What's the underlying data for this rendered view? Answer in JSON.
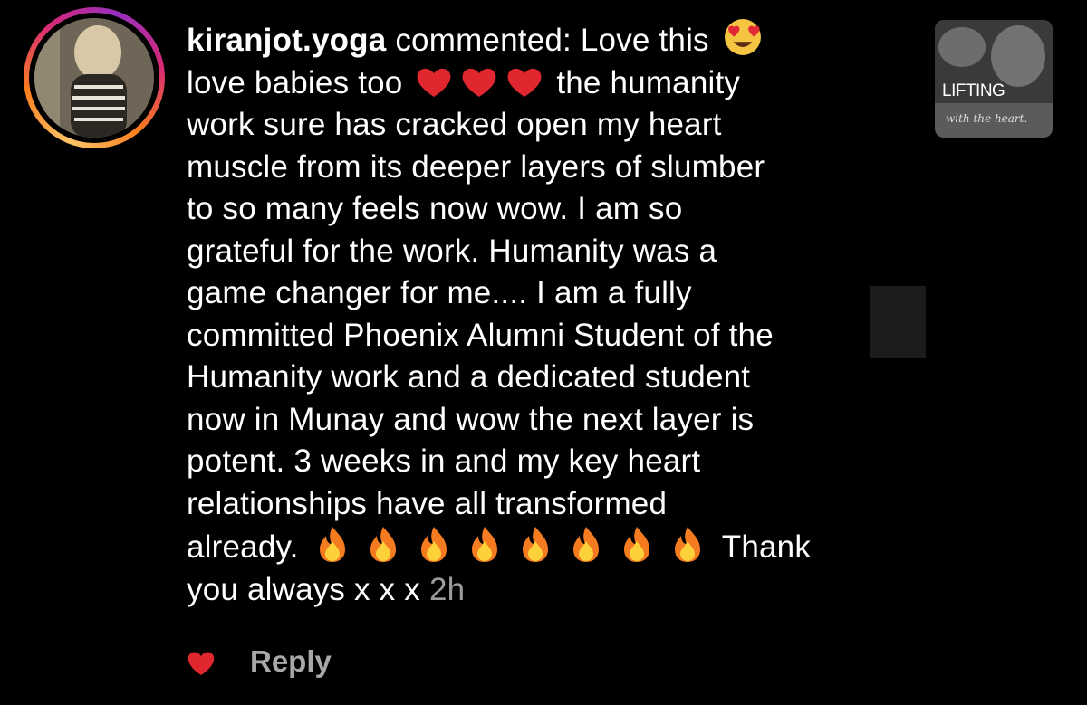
{
  "comment": {
    "username": "kiranjot.yoga",
    "lines": {
      "l1": " commented: Love this",
      "l2a": "love babies too",
      "l2b": " the humanity",
      "l3": "work sure has cracked open my heart",
      "l4": "muscle from its deeper layers of slumber",
      "l5": "to so many feels now wow. I am so",
      "l6": "grateful for the work. Humanity was a",
      "l7": "game changer for me.... I am a fully",
      "l8": "committed Phoenix Alumni Student of the",
      "l9": "Humanity work and a dedicated student",
      "l10": "now in Munay and wow the next layer is",
      "l11": "potent. 3 weeks in and my key heart",
      "l12": "relationships have all transformed",
      "l13a": "already.",
      "l13b": " Thank",
      "l14": "you always x x x "
    },
    "time": "2h",
    "emoji": {
      "after_l1": "heart-eyes-emoji",
      "hearts": "red-heart-emoji x3",
      "fires": "fire-emoji x8"
    }
  },
  "actions": {
    "reply_label": "Reply",
    "like_icon": "heart-icon"
  },
  "post_thumbnail": {
    "title": "LIFTING",
    "subtitle": "with the heart."
  },
  "colors": {
    "background": "#000000",
    "text": "#ffffff",
    "timestamp": "#9b9b9b",
    "reply": "#a8a8a8",
    "heart": "#e0262f"
  }
}
